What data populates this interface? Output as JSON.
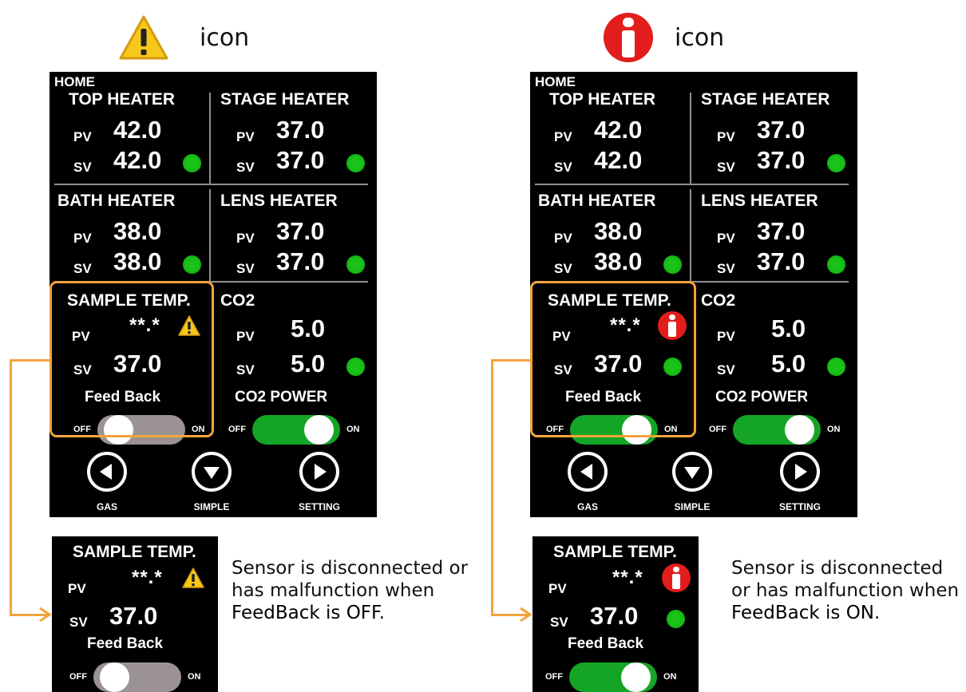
{
  "captions": {
    "left": "icon",
    "right": "icon"
  },
  "icons": {
    "left": "warning-triangle-icon",
    "right": "info-circle-icon"
  },
  "screen": {
    "home": "HOME",
    "top_heater": {
      "title": "TOP HEATER",
      "pv_label": "PV",
      "sv_label": "SV",
      "pv": "42.0",
      "sv": "42.0"
    },
    "stage_heater": {
      "title": "STAGE HEATER",
      "pv_label": "PV",
      "sv_label": "SV",
      "pv": "37.0",
      "sv": "37.0"
    },
    "bath_heater": {
      "title": "BATH HEATER",
      "pv_label": "PV",
      "sv_label": "SV",
      "pv": "38.0",
      "sv": "38.0"
    },
    "lens_heater": {
      "title": "LENS HEATER",
      "pv_label": "PV",
      "sv_label": "SV",
      "pv": "37.0",
      "sv": "37.0"
    },
    "sample_temp": {
      "title": "SAMPLE TEMP.",
      "pv_label": "PV",
      "sv_label": "SV",
      "pv": "**.*",
      "sv": "37.0",
      "feedback_label": "Feed Back"
    },
    "co2": {
      "title": "CO2",
      "pv_label": "PV",
      "sv_label": "SV",
      "pv": "5.0",
      "sv": "5.0",
      "power_label": "CO2 POWER"
    },
    "switch": {
      "off": "OFF",
      "on": "ON"
    },
    "nav": {
      "gas": "GAS",
      "simple": "SIMPLE",
      "setting": "SETTING"
    }
  },
  "feedback_states": {
    "left": "off",
    "right": "on"
  },
  "notes": {
    "left": {
      "text": "Sensor is disconnected or has malfunction when",
      "highlight": "FeedBack is OFF",
      "end": "."
    },
    "right": {
      "text": "Sensor is disconnected or has malfunction when",
      "highlight": "FeedBack is ON",
      "end": "."
    }
  },
  "colors": {
    "accent_orange": "#f2a43c",
    "status_green": "#1ac21a",
    "switch_on": "#14a526",
    "switch_off": "#9b9393",
    "info_red": "#e31d1c",
    "warning_yellow": "#f7c81b"
  }
}
